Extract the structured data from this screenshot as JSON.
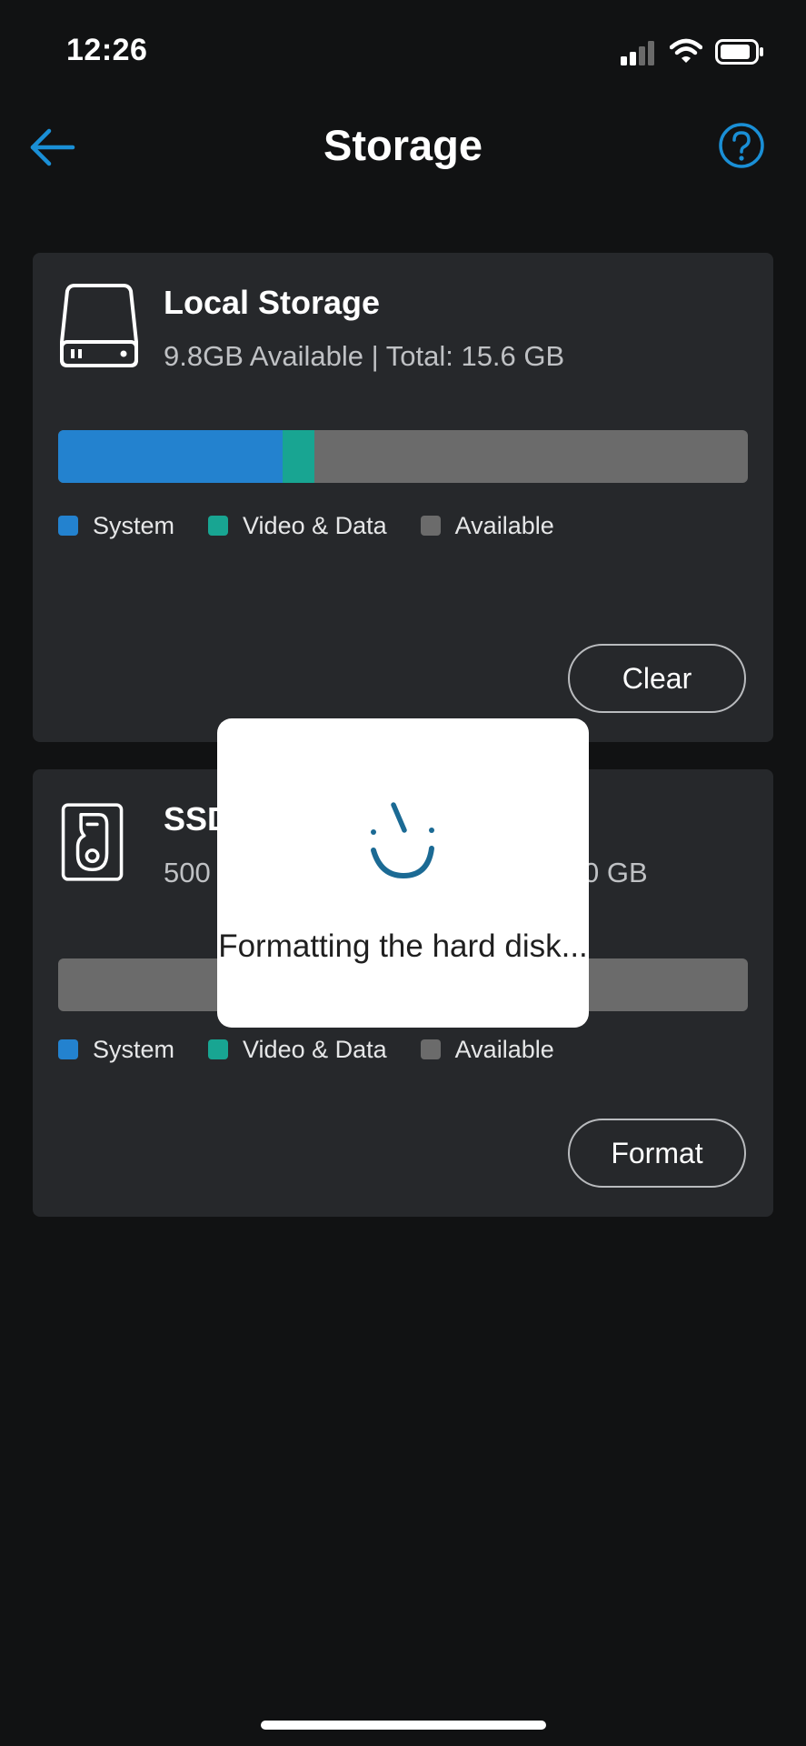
{
  "status_bar": {
    "time": "12:26",
    "icons": [
      "signal-icon",
      "wifi-icon",
      "battery-icon"
    ]
  },
  "nav": {
    "back_icon": "arrow-left-icon",
    "title": "Storage",
    "help_icon": "question-circle-icon"
  },
  "local_storage": {
    "icon": "hard-drive-icon",
    "title": "Local Storage",
    "subtitle": "9.8GB Available | Total:  15.6 GB",
    "usage": {
      "system": 0.325,
      "video_data": 0.046,
      "available": 0.629
    },
    "legend": [
      {
        "label": "System",
        "color": "#2382cf"
      },
      {
        "label": "Video & Data",
        "color": "#18a592"
      },
      {
        "label": "Available",
        "color": "#6b6b6b"
      }
    ],
    "button_label": "Clear"
  },
  "ssd": {
    "icon": "ssd-disk-icon",
    "title": "SSD",
    "subtitle": "500",
    "subtitle_tail": "0 GB",
    "usage": {
      "system": 0,
      "video_data": 0,
      "available": 1
    },
    "legend": [
      {
        "label": "System",
        "color": "#2382cf"
      },
      {
        "label": "Video & Data",
        "color": "#18a592"
      },
      {
        "label": "Available",
        "color": "#6b6b6b"
      }
    ],
    "button_label": "Format"
  },
  "modal": {
    "message": "Formatting the hard disk..."
  },
  "colors": {
    "accent": "#1a8fd6",
    "background": "#111213",
    "card": "#26282b"
  }
}
